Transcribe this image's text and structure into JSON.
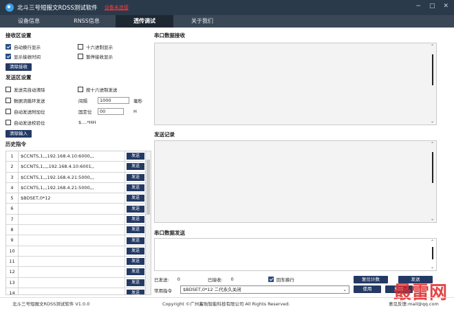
{
  "app": {
    "title": "北斗三号短报文RDSS测试软件",
    "connection_status": "设备未连接",
    "window_controls": {
      "minimize": "−",
      "maximize": "□",
      "close": "✕"
    }
  },
  "tabs": [
    "设备信息",
    "RNSS信息",
    "透传调试",
    "关于我们"
  ],
  "active_tab": "透传调试",
  "receive_settings": {
    "title": "接收区设置",
    "auto_wrap": "自动换行显示",
    "hex_display": "十六进制显示",
    "show_time": "显示接收时间",
    "pause_display": "暂停接收显示",
    "clear_button": "清除接收"
  },
  "send_settings": {
    "title": "发送区设置",
    "auto_clear": "发送完自动清除",
    "hex_send": "按十六进制发送",
    "loop_send": "数据流循环发送",
    "interval_label": "间隔",
    "interval_value": "1000",
    "interval_unit": "毫秒",
    "append_checksum": "自动发送附加位",
    "fixed_label": "固定位",
    "fixed_value": "00",
    "fixed_unit": "H",
    "auto_checksum": "自动发送校验位",
    "checksum_format": "$....*HH",
    "clear_button": "清除输入"
  },
  "history": {
    "title": "历史指令",
    "send_label": "发送",
    "rows": [
      {
        "num": "1",
        "cmd": "$CCNTS,1,,,192.168.4.10:6000,,,"
      },
      {
        "num": "2",
        "cmd": "$CCNTS,1,,,,192.168.4.10:6001,,"
      },
      {
        "num": "3",
        "cmd": "$CCNTS,1,,,192.168.4.21:5000,,,"
      },
      {
        "num": "4",
        "cmd": "$CCNTS,1,,,192.168.4.21:5000,,,"
      },
      {
        "num": "5",
        "cmd": "$BDSET,0*12"
      },
      {
        "num": "6",
        "cmd": ""
      },
      {
        "num": "7",
        "cmd": ""
      },
      {
        "num": "8",
        "cmd": ""
      },
      {
        "num": "9",
        "cmd": ""
      },
      {
        "num": "10",
        "cmd": ""
      },
      {
        "num": "11",
        "cmd": ""
      },
      {
        "num": "12",
        "cmd": ""
      },
      {
        "num": "13",
        "cmd": ""
      },
      {
        "num": "14",
        "cmd": ""
      }
    ]
  },
  "right": {
    "receive_title": "串口数据接收",
    "send_log_title": "发送记录",
    "send_title": "串口数据发送",
    "sent_label": "已发送:",
    "sent_value": "0",
    "received_label": "已接收:",
    "received_value": "0",
    "crlf_label": "回车换行",
    "reset_button": "复位计数",
    "send_button": "发送",
    "common_cmd_label": "常用指令",
    "common_cmd_value": "$BDSET,0*12 二代永久关闭",
    "use_button": "使用",
    "delete_button": "删除"
  },
  "footer": {
    "version": "北斗三号短报文RDSS测试软件 V1.0.0",
    "copyright": "Copyright ©广州蓄贻智能科技有限公司 All Rights Reserved.",
    "feedback": "意见反馈:mail@qq.com"
  },
  "watermark": "最雷网"
}
